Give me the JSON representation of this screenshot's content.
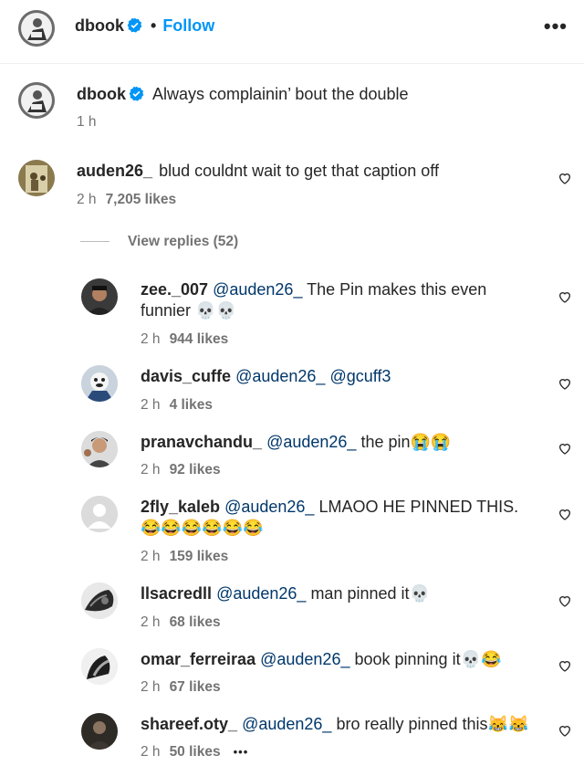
{
  "header": {
    "username": "dbook",
    "separator": "•",
    "follow_label": "Follow",
    "more_label": "•••"
  },
  "caption": {
    "username": "dbook",
    "text": "Always complainin’ bout the double",
    "time": "1 h"
  },
  "comment": {
    "username": "auden26_",
    "text": "blud couldnt wait to get that caption off",
    "time": "2 h",
    "likes": "7,205 likes"
  },
  "view_replies_label": "View replies (52)",
  "replies": [
    {
      "username": "zee._007",
      "mention": "@auden26_",
      "text": "The Pin makes this even",
      "text2": "funnier 💀💀",
      "time": "2 h",
      "likes": "944 likes"
    },
    {
      "username": "davis_cuffe",
      "mention": "@auden26_",
      "text": "@gcuff3",
      "time": "2 h",
      "likes": "4 likes"
    },
    {
      "username": "pranavchandu_",
      "mention": "@auden26_",
      "text": "the pin😭😭",
      "time": "2 h",
      "likes": "92 likes"
    },
    {
      "username": "2fly_kaleb",
      "mention": "@auden26_",
      "text": "LMAOO HE PINNED THIS.",
      "text2": "😂😂😂😂😂😂",
      "time": "2 h",
      "likes": "159 likes"
    },
    {
      "username": "llsacredll",
      "mention": "@auden26_",
      "text": "man pinned it💀",
      "time": "2 h",
      "likes": "68 likes"
    },
    {
      "username": "omar_ferreiraa",
      "mention": "@auden26_",
      "text": "book pinning it💀😂",
      "time": "2 h",
      "likes": "67 likes"
    },
    {
      "username": "shareef.oty_",
      "mention": "@auden26_",
      "text": "bro really pinned this😹😹",
      "time": "2 h",
      "likes": "50 likes",
      "more": "•••"
    }
  ],
  "colors": {
    "link": "#0095f6",
    "mention": "#00376b",
    "verified": "#0095f6",
    "meta": "#737373"
  }
}
